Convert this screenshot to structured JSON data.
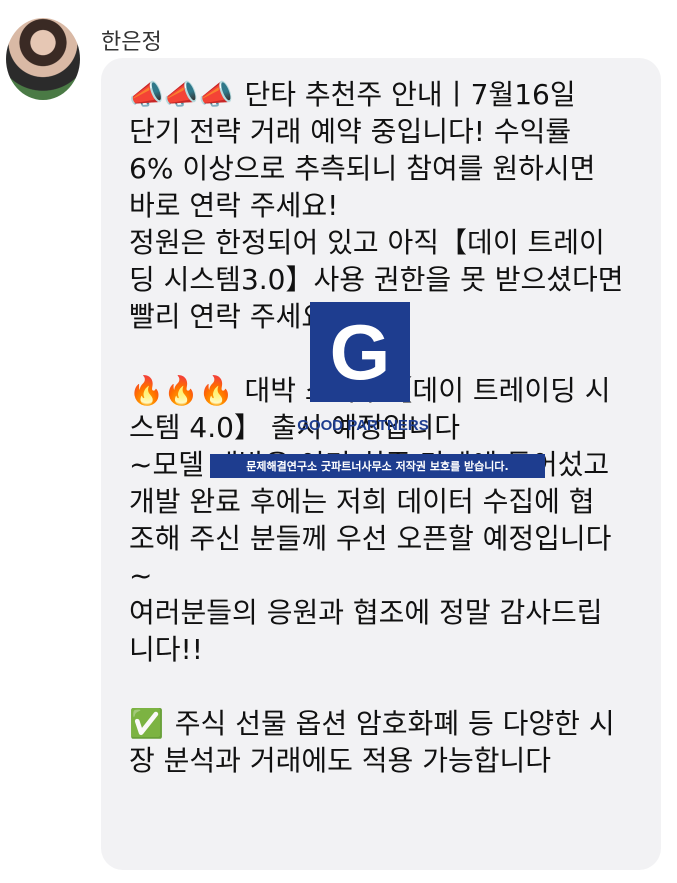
{
  "message": {
    "sender": "한은정",
    "lines": [
      {
        "emoji": "📣📣📣",
        "text": " 단타 추천주 안내丨7월16일"
      },
      {
        "emoji": "",
        "text": "단기 전략 거래 예약 중입니다! 수익률"
      },
      {
        "emoji": "",
        "text": "6% 이상으로 추측되니 참여를 원하시면"
      },
      {
        "emoji": "",
        "text": "바로 연락 주세요!"
      },
      {
        "emoji": "",
        "text": "정원은 한정되어 있고 아직【데이 트레이"
      },
      {
        "emoji": "",
        "text": "딩 시스템3.0】사용 권한을 못 받으셨다면"
      },
      {
        "emoji": "",
        "text": "빨리 연락 주세요"
      },
      {
        "emoji": "",
        "text": ""
      },
      {
        "emoji": "🔥🔥🔥",
        "text": " 대박 소식丨【데이 트레이딩 시"
      },
      {
        "emoji": "",
        "text": "스템 4.0】 출시 예정입니다"
      },
      {
        "emoji": "",
        "text": "~모델 개발은 이미 최종 단계에 들어섰고"
      },
      {
        "emoji": "",
        "text": "개발 완료 후에는 저희 데이터 수집에 협"
      },
      {
        "emoji": "",
        "text": "조해 주신 분들께 우선 오픈할 예정입니다"
      },
      {
        "emoji": "",
        "text": "~"
      },
      {
        "emoji": "",
        "text": "여러분들의 응원과 협조에 정말 감사드립"
      },
      {
        "emoji": "",
        "text": "니다!!"
      },
      {
        "emoji": "",
        "text": ""
      },
      {
        "emoji": "✅",
        "text": " 주식 선물 옵션 암호화폐 등 다양한 시"
      },
      {
        "emoji": "",
        "text": "장 분석과 거래에도 적용 가능합니다"
      }
    ]
  },
  "watermark": {
    "logo_letter": "G",
    "brand": "GOOD PARTNERS",
    "copyright": "문제해결연구소 굿파트너사무소 저작권 보호를 받습니다."
  }
}
